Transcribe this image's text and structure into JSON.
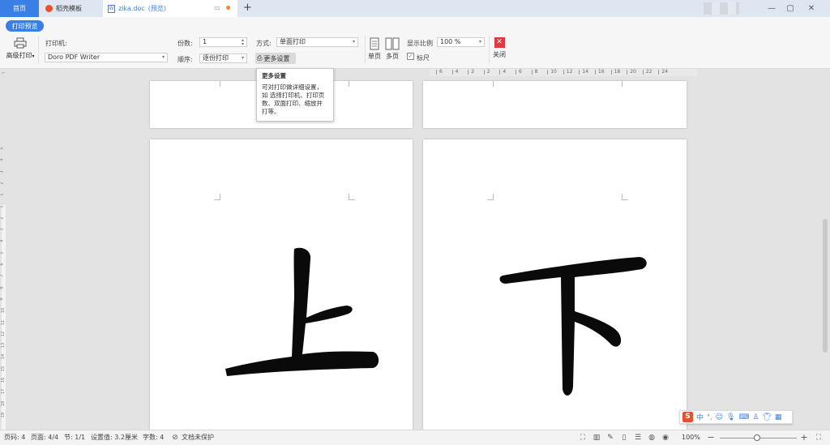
{
  "tabs": {
    "home": "首页",
    "template": "稻壳模板",
    "doc_name": "zika.doc",
    "doc_status": "(预览)"
  },
  "toolbar": {
    "print_preview_pill": "打印预览",
    "advanced_print": "高级打印",
    "printer_label": "打印机:",
    "printer_value": "Doro PDF Writer",
    "copies_label": "份数:",
    "copies_value": "1",
    "order_label": "顺序:",
    "order_value": "逐份打印",
    "mode_label": "方式:",
    "mode_value": "单面打印",
    "more_settings": "更多设置",
    "single_page": "单页",
    "multi_page": "多页",
    "zoom_label": "显示比例",
    "zoom_value": "100 %",
    "ruler_checkbox": "标尺",
    "close": "关闭"
  },
  "tooltip": {
    "title": "更多设置",
    "body": "可对打印做详细设置，如 选择打印机、打印页数、双面打印、缩放并打等。"
  },
  "ruler": {
    "ticks": [
      "6",
      "4",
      "2",
      "2",
      "4",
      "6",
      "8",
      "10",
      "12",
      "14",
      "16",
      "18",
      "20",
      "22",
      "24"
    ]
  },
  "vruler": {
    "ticks": [
      "5",
      "4",
      "3",
      "2",
      "1",
      "1",
      "2",
      "3",
      "4",
      "5",
      "6",
      "7",
      "8",
      "9",
      "10",
      "11",
      "12",
      "13",
      "14",
      "15",
      "16",
      "17",
      "18",
      "19"
    ]
  },
  "pages": {
    "left_char": "上",
    "right_char": "下"
  },
  "status": {
    "page_code": "页码: 4",
    "pages": "页面: 4/4",
    "section": "节: 1/1",
    "setting": "设置值: 3.2厘米",
    "words": "字数: 4",
    "protect": "文档未保护",
    "zoom": "100%"
  },
  "ime": {
    "logo": "S",
    "mode": "中"
  },
  "colors": {
    "accent": "#3a7fe6",
    "close_red": "#e0393e",
    "page_bg": "#ffffff",
    "canvas_bg": "#e3e3e3"
  }
}
